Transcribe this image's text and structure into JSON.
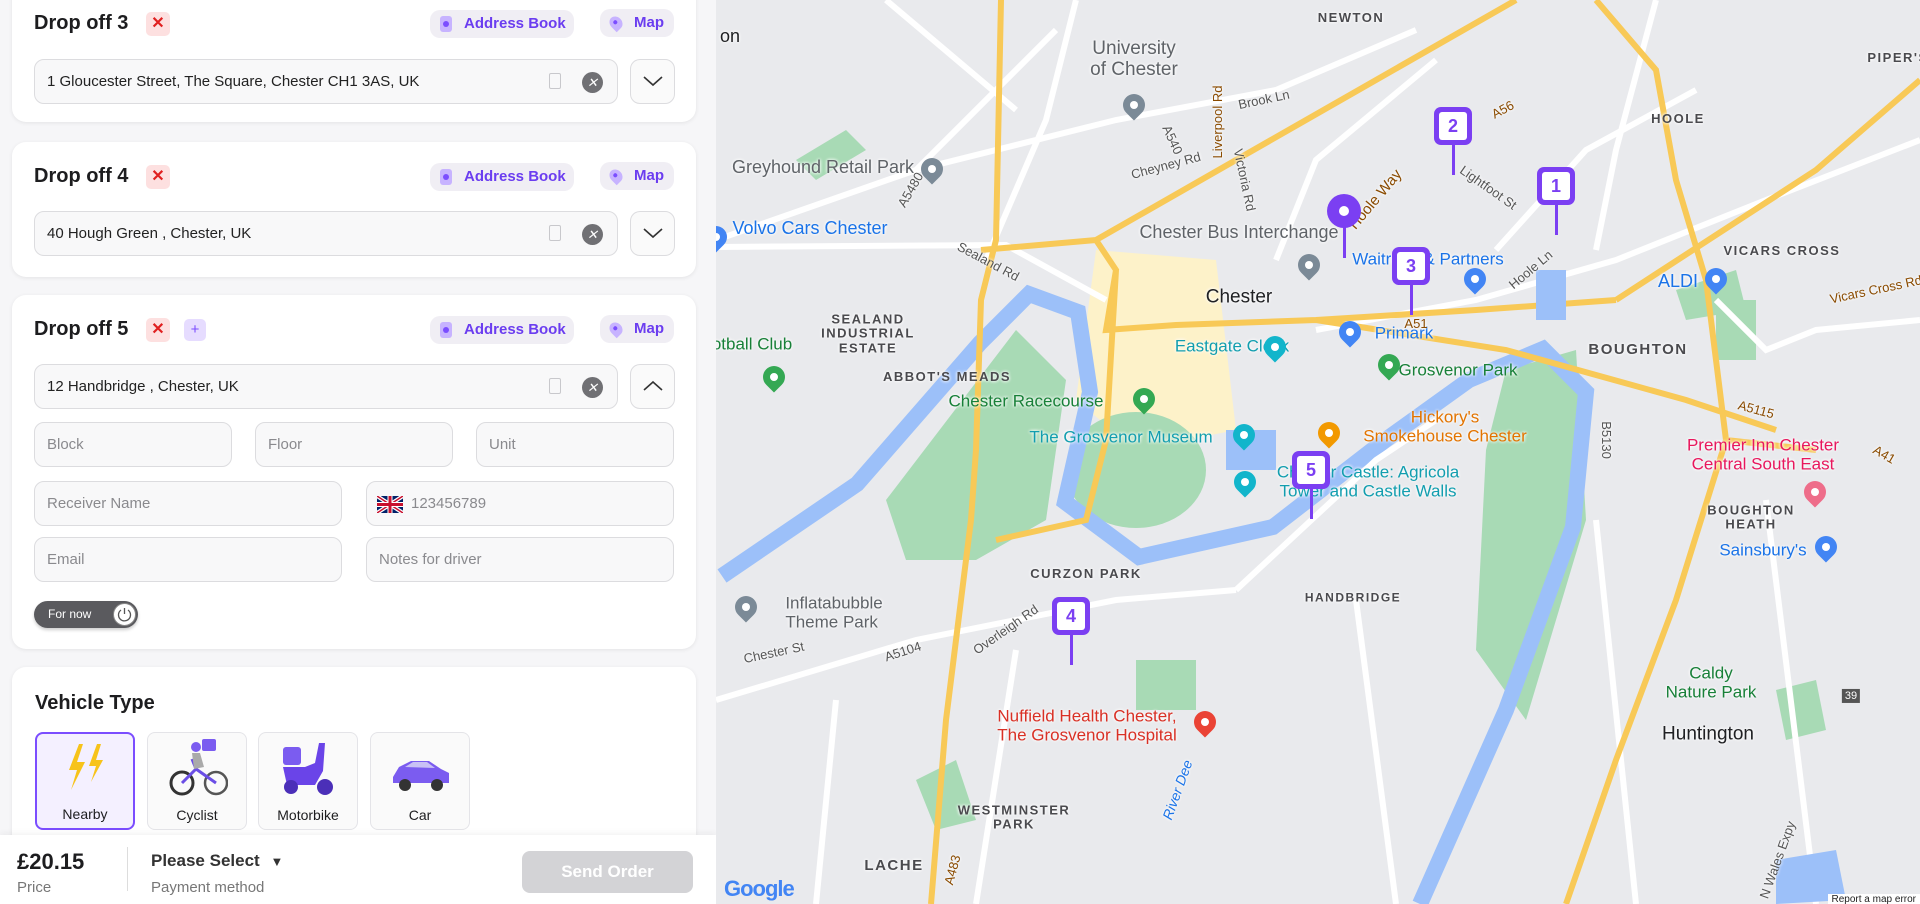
{
  "dropoffs": [
    {
      "title": "Drop off 3",
      "remove": "✕",
      "address_book": "Address Book",
      "map": "Map",
      "address": "1 Gloucester Street, The Square, Chester CH1 3AS, UK",
      "expanded": false
    },
    {
      "title": "Drop off 4",
      "remove": "✕",
      "address_book": "Address Book",
      "map": "Map",
      "address": "40 Hough Green , Chester, UK",
      "expanded": false
    },
    {
      "title": "Drop off 5",
      "remove": "✕",
      "add": "+",
      "address_book": "Address Book",
      "map": "Map",
      "address": "12 Handbridge , Chester, UK",
      "expanded": true,
      "fields": {
        "block": "Block",
        "floor": "Floor",
        "unit": "Unit",
        "receiver": "Receiver Name",
        "phone": "123456789",
        "email": "Email",
        "notes": "Notes for driver"
      },
      "toggle": "For now"
    }
  ],
  "vehicle": {
    "title": "Vehicle Type",
    "selected": "Nearby",
    "options": [
      "Nearby",
      "Cyclist",
      "Motorbike",
      "Car"
    ]
  },
  "footer": {
    "price": "£20.15",
    "price_label": "Price",
    "payment": "Please Select",
    "payment_caret": "▼",
    "payment_label": "Payment method",
    "send": "Send Order"
  },
  "colors": {
    "accent": "#7b3ff2",
    "danger": "#e02020"
  },
  "map": {
    "markers": [
      "1",
      "2",
      "3",
      "4",
      "5"
    ],
    "labels": [
      "on",
      "NEWTON",
      "University\nof Chester",
      "Brook Ln",
      "HOOLE",
      "PIPER'S",
      "Greyhound Retail Park",
      "Cheyney Rd",
      "Liverpool Rd",
      "Victoria Rd",
      "A5480",
      "Volvo Cars Chester",
      "Chester Bus Interchange",
      "Waitrose & Partners",
      "VICARS CROSS",
      "ALDI",
      "Chester",
      "Primark",
      "A51",
      "BOUGHTON",
      "Eastgate Clock",
      "Grosvenor Park",
      "SEALAND\nINDUSTRIAL\nESTATE",
      "otball Club",
      "ABBOT'S MEADS",
      "Chester Racecourse",
      "The Grosvenor Museum",
      "Hickory's\nSmokehouse Chester",
      "Premier Inn Chester\nCentral South East",
      "A5115",
      "A41",
      "Chester Castle: Agricola\nTower and Castle Walls",
      "BOUGHTON\nHEATH",
      "Sainsbury's",
      "CURZON PARK",
      "HANDBRIDGE",
      "Inflatabubble\nTheme Park",
      "Chester St",
      "A5104",
      "Overleigh Rd",
      "Caldy\nNature Park",
      "Nuffield Health Chester,\nThe Grosvenor Hospital",
      "Huntington",
      "WESTMINSTER\nPARK",
      "LACHE",
      "A483",
      "River Dee",
      "N Wales Expy",
      "39",
      "A56",
      "Hoole Way",
      "Hoole Ln",
      "Lightfoot St",
      "Vicars Cross Rd",
      "B5130",
      "Sealand Rd",
      "A540"
    ],
    "google": "Google",
    "report": "Report a map error"
  }
}
